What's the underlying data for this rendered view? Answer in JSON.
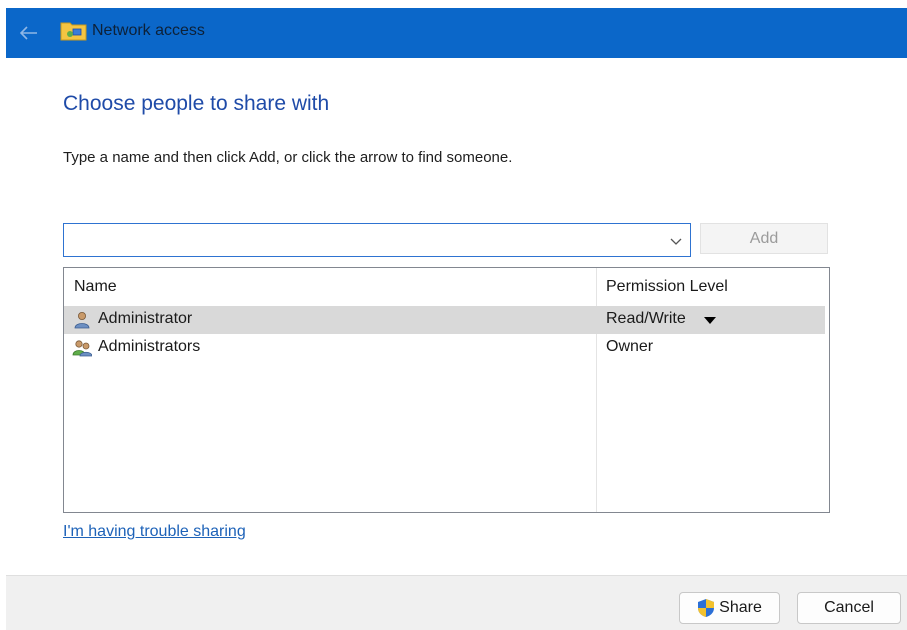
{
  "window": {
    "title": "Network access",
    "back_icon": "back-arrow-icon",
    "folder_icon": "network-folder-icon"
  },
  "main": {
    "heading": "Choose people to share with",
    "instruction": "Type a name and then click Add, or click the arrow to find someone.",
    "name_input": {
      "value": "",
      "placeholder": ""
    },
    "dropdown_icon": "chevron-down-icon",
    "add_label": "Add"
  },
  "list": {
    "columns": [
      "Name",
      "Permission Level"
    ],
    "rows": [
      {
        "name": "Administrator",
        "permission": "Read/Write",
        "icon": "user-icon",
        "selected": true,
        "has_dropdown": true
      },
      {
        "name": "Administrators",
        "permission": "Owner",
        "icon": "user-group-icon",
        "selected": false,
        "has_dropdown": false
      }
    ]
  },
  "trouble_link": "I'm having trouble sharing",
  "footer": {
    "share_label": "Share",
    "share_icon": "uac-shield-icon",
    "cancel_label": "Cancel"
  },
  "colors": {
    "titlebar": "#0b67c9",
    "heading": "#1f4ba8",
    "link": "#1d62b8",
    "selected_row": "#d9d9d9",
    "input_border": "#2e73d1"
  }
}
